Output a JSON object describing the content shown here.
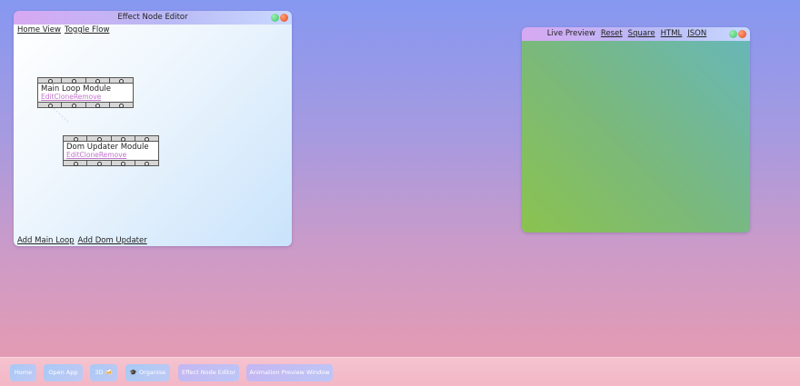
{
  "editor": {
    "title": "Effect Node Editor",
    "top_links": [
      "Home View",
      "Toggle Flow"
    ],
    "bottom_links": [
      "Add Main Loop",
      "Add Dom Updater"
    ],
    "nodes": [
      {
        "title": "Main Loop Module",
        "actions": [
          "Edit",
          "Clone",
          "Remove"
        ]
      },
      {
        "title": "Dom Updater Module",
        "actions": [
          "Edit",
          "Clone",
          "Remove"
        ]
      }
    ]
  },
  "preview": {
    "title": "Live Preview",
    "links": [
      "Reset",
      "Square",
      "HTML",
      "JSON"
    ]
  },
  "taskbar": {
    "items": [
      "Home",
      "Open App",
      "3D",
      "Organise",
      "Effect Node Editor",
      "Animation Preview Window"
    ],
    "icons": {
      "3D": "🍻",
      "Organise": "🎓"
    }
  },
  "colors": {
    "window_control_green": "#3cbf6e",
    "window_control_red": "#e5461b",
    "node_action_link": "#c075c9"
  }
}
